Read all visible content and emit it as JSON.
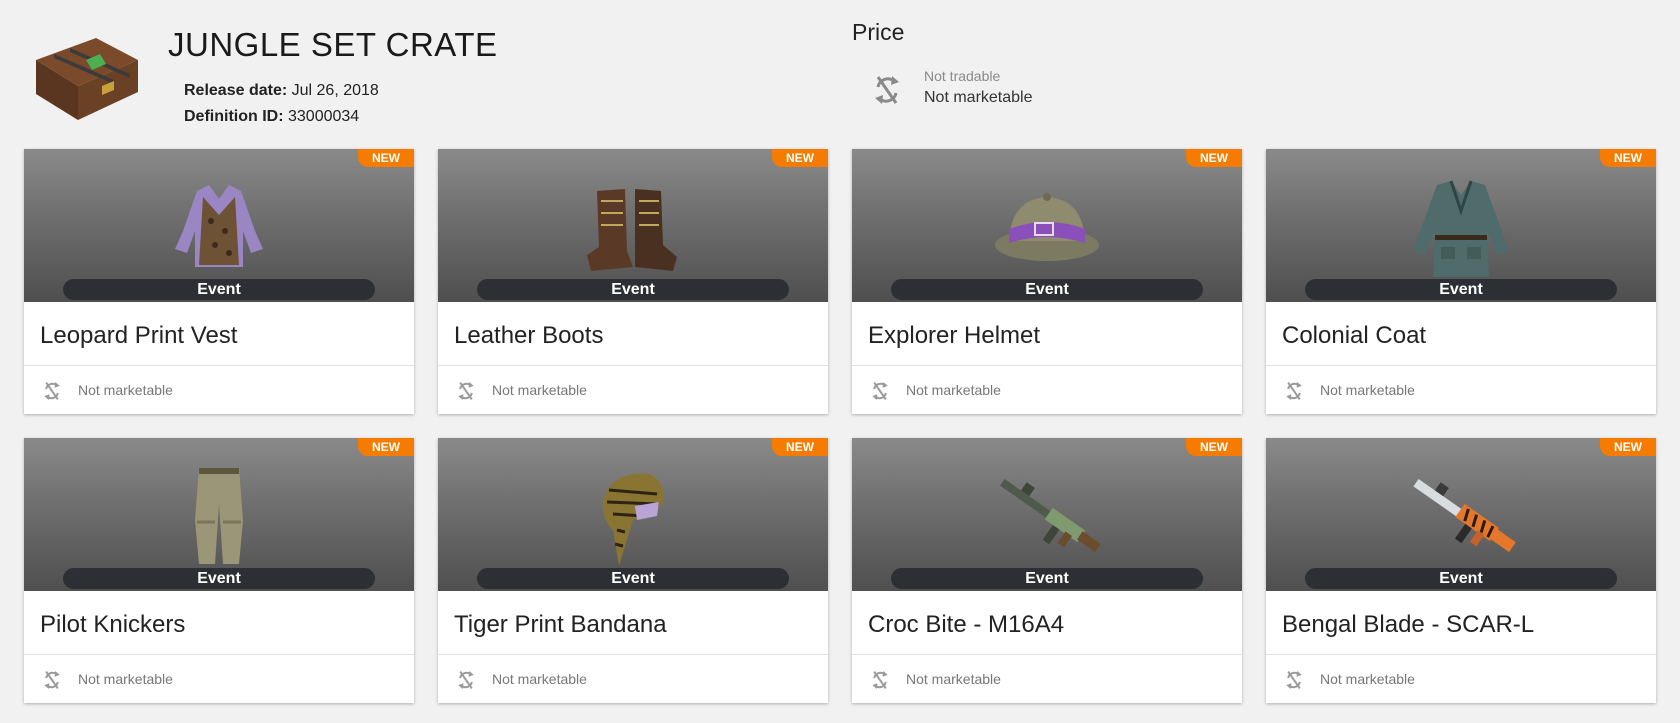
{
  "crate": {
    "title": "JUNGLE SET CRATE",
    "release_label": "Release date:",
    "release_value": "Jul 26, 2018",
    "defid_label": "Definition ID:",
    "defid_value": "33000034"
  },
  "price": {
    "title": "Price",
    "tradable": "Not tradable",
    "marketable": "Not marketable"
  },
  "colors": {
    "ribbon": "#f57c00",
    "pill": "#2c2f33",
    "background": "#f1f1f1"
  },
  "items": [
    {
      "name": "Leopard Print Vest",
      "badge": "NEW",
      "tag": "Event",
      "status": "Not marketable",
      "icon": "vest-icon"
    },
    {
      "name": "Leather Boots",
      "badge": "NEW",
      "tag": "Event",
      "status": "Not marketable",
      "icon": "boots-icon"
    },
    {
      "name": "Explorer Helmet",
      "badge": "NEW",
      "tag": "Event",
      "status": "Not marketable",
      "icon": "helmet-icon"
    },
    {
      "name": "Colonial Coat",
      "badge": "NEW",
      "tag": "Event",
      "status": "Not marketable",
      "icon": "coat-icon"
    },
    {
      "name": "Pilot Knickers",
      "badge": "NEW",
      "tag": "Event",
      "status": "Not marketable",
      "icon": "pants-icon"
    },
    {
      "name": "Tiger Print Bandana",
      "badge": "NEW",
      "tag": "Event",
      "status": "Not marketable",
      "icon": "bandana-icon"
    },
    {
      "name": "Croc Bite - M16A4",
      "badge": "NEW",
      "tag": "Event",
      "status": "Not marketable",
      "icon": "rifle-icon"
    },
    {
      "name": "Bengal Blade - SCAR-L",
      "badge": "NEW",
      "tag": "Event",
      "status": "Not marketable",
      "icon": "rifle-icon"
    }
  ]
}
